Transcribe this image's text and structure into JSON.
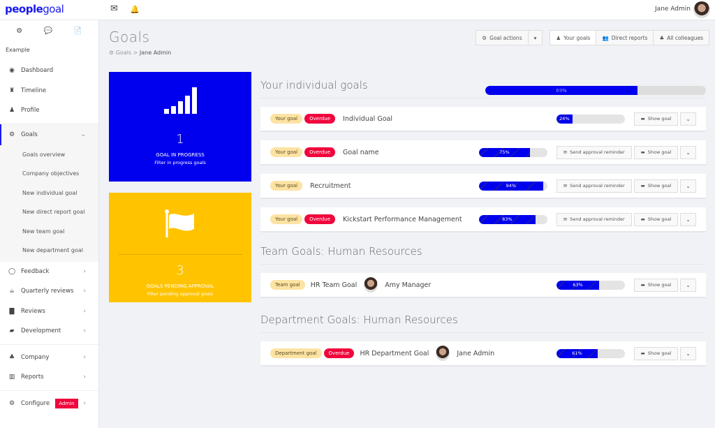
{
  "topbar": {
    "logo_bold": "people",
    "logo_light": "goal",
    "mail_icon": "✉",
    "bell_icon": "🔔",
    "user_name": "Jane Admin"
  },
  "sidebar": {
    "top_icons": [
      "⚙",
      "💬",
      "📄"
    ],
    "org_label": "Example",
    "main_items": [
      {
        "label": "Dashboard",
        "icon": "◉"
      },
      {
        "label": "Timeline",
        "icon": "♜"
      },
      {
        "label": "Profile",
        "icon": "♟"
      }
    ],
    "goals": {
      "label": "Goals",
      "icon": "⚙",
      "chevron": "⌄",
      "sub_items": [
        "Goals overview",
        "Company objectives",
        "New individual goal",
        "New direct report goal",
        "New team goal",
        "New department goal"
      ]
    },
    "group2": [
      {
        "label": "Feedback",
        "icon": "◯",
        "chevron": "›"
      },
      {
        "label": "Quarterly reviews",
        "icon": "☕",
        "chevron": "›"
      },
      {
        "label": "Reviews",
        "icon": "▇",
        "chevron": "›"
      },
      {
        "label": "Development",
        "icon": "▰",
        "chevron": "›"
      }
    ],
    "group3": [
      {
        "label": "Company",
        "icon": "♣",
        "chevron": "›"
      },
      {
        "label": "Reports",
        "icon": "▥",
        "chevron": "›"
      }
    ],
    "configure": {
      "label": "Configure",
      "icon": "⚙",
      "badge": "Admin",
      "chevron": "›"
    }
  },
  "page": {
    "title": "Goals",
    "breadcrumb": {
      "icon": "⚙",
      "root": "Goals",
      "separator": ">",
      "current": "Jane Admin"
    }
  },
  "actions": {
    "goal_actions": "Goal actions",
    "goal_actions_caret": "▾",
    "views": [
      {
        "label": "Your goals",
        "icon": "♟",
        "active": true
      },
      {
        "label": "Direct reports",
        "icon": "👥",
        "active": false
      },
      {
        "label": "All colleagues",
        "icon": "♣",
        "active": false
      }
    ]
  },
  "cards": {
    "in_progress": {
      "count": "1",
      "label": "GOAL IN PROGRESS",
      "sub": "Filter in progress goals",
      "color": "#0000ef"
    },
    "pending": {
      "count": "3",
      "label": "GOALS PENDING APPROVAL",
      "sub": "Filter pending approval goals",
      "color": "#ffc300"
    }
  },
  "sections": {
    "individual": {
      "title": "Your individual goals",
      "overall_progress": 69,
      "overall_label": "69%",
      "goals": [
        {
          "tag": "Your goal",
          "overdue": "Overdue",
          "name": "Individual Goal",
          "progress": 24,
          "progress_label": "24%",
          "reminder": "",
          "show": "Show goal"
        },
        {
          "tag": "Your goal",
          "overdue": "Overdue",
          "name": "Goal name",
          "progress": 75,
          "progress_label": "75%",
          "reminder": "Send approval reminder",
          "show": "Show goal"
        },
        {
          "tag": "Your goal",
          "overdue": "",
          "name": "Recruitment",
          "progress": 94,
          "progress_label": "94%",
          "reminder": "Send approval reminder",
          "show": "Show goal"
        },
        {
          "tag": "Your goal",
          "overdue": "Overdue",
          "name": "Kickstart Performance Management",
          "progress": 83,
          "progress_label": "83%",
          "reminder": "Send approval reminder",
          "show": "Show goal"
        }
      ]
    },
    "team": {
      "title": "Team Goals: Human Resources",
      "goals": [
        {
          "tag": "Team goal",
          "name": "HR Team Goal",
          "owner": "Amy Manager",
          "progress": 63,
          "progress_label": "63%",
          "show": "Show goal"
        }
      ]
    },
    "department": {
      "title": "Department Goals: Human Resources",
      "goals": [
        {
          "tag": "Department goal",
          "overdue": "Overdue",
          "name": "HR Department Goal",
          "owner": "Jane Admin",
          "progress": 61,
          "progress_label": "61%",
          "show": "Show goal"
        }
      ]
    }
  },
  "icons": {
    "mail": "✉",
    "folder": "▬",
    "caret_down": "⌄"
  },
  "colors": {
    "brand": "#1a1aef",
    "overdue": "#f0063c",
    "tag": "#fde3a3"
  }
}
